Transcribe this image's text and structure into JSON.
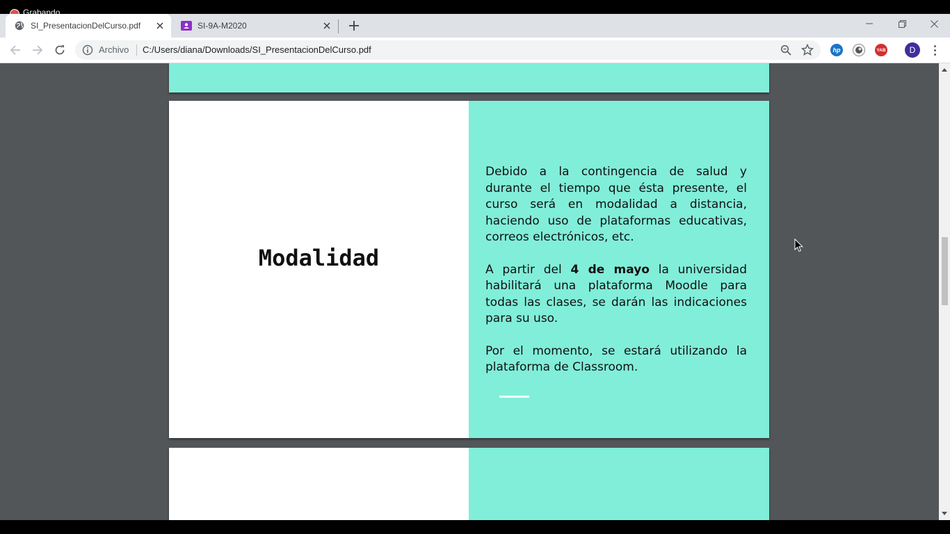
{
  "recording": {
    "label": "Grabando"
  },
  "tabs": [
    {
      "title": "SI_PresentacionDelCurso.pdf",
      "icon": "globe-icon",
      "active": true
    },
    {
      "title": "SI-9A-M2020",
      "icon": "classroom-icon",
      "active": false
    }
  ],
  "address_bar": {
    "security_chip": "Archivo",
    "url": "C:/Users/diana/Downloads/SI_PresentacionDelCurso.pdf"
  },
  "profile": {
    "initial": "D",
    "color": "#3f2f9e"
  },
  "extensions": [
    {
      "name": "hp-icon",
      "color": "#1a73c8",
      "label": "hp"
    },
    {
      "name": "circle-extension-icon",
      "color": "#444444",
      "label": ""
    },
    {
      "name": "yab-icon",
      "color": "#d32f2f",
      "label": "YAB"
    }
  ],
  "slide": {
    "title": "Modalidad",
    "paragraph1": "Debido a la contingencia de salud y durante el tiempo que ésta presente, el curso será en modalidad a distancia, haciendo uso de plataformas educativas, correos electrónicos, etc.",
    "paragraph2_before": "A partir del ",
    "paragraph2_bold": "4 de mayo",
    "paragraph2_after": " la universidad habilitará una plataforma Moodle para todas las clases, se darán las indicaciones para su uso.",
    "paragraph3": "Por el momento, se estará utilizando la plataforma de Classroom.",
    "accent_color": "#81eed9"
  },
  "viewer": {
    "background": "#525659"
  }
}
